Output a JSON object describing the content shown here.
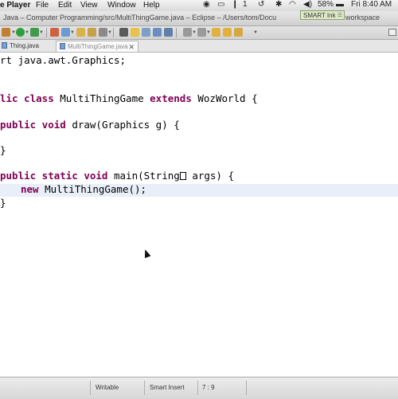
{
  "menubar": {
    "app_name": "e Player",
    "menus": [
      "File",
      "Edit",
      "View",
      "Window",
      "Help"
    ],
    "battery": "58%",
    "clock": "Fri 8:40 AM"
  },
  "smart_ink": {
    "label": "SMART Ink"
  },
  "window": {
    "title": "Java – Computer Programming/src/MultiThingGame.java – Eclipse – /Users/tom/Docu",
    "title_right": "workspace"
  },
  "tabs": [
    {
      "label": "Thing.java"
    },
    {
      "label": "MultiThingGame.java",
      "close": "✕"
    }
  ],
  "code": {
    "line1": {
      "plain": "rt java.awt.Graphics;"
    },
    "line2": {
      "kw1": "lic class ",
      "name": "MultiThingGame ",
      "kw2": "extends ",
      "tail": "WozWorld {"
    },
    "line3": {
      "kw": "public void ",
      "tail": "draw(Graphics g) {"
    },
    "line4": {
      "plain": "}"
    },
    "line5": {
      "kw": "public static void ",
      "head": "main(String",
      "tail": " args) {"
    },
    "line6": {
      "kw": "new ",
      "tail": "MultiThingGame();"
    },
    "line7": {
      "plain": "}"
    }
  },
  "statusbar": {
    "mode": "Writable",
    "insert": "Smart Insert",
    "position": "7 : 9"
  },
  "colors": {
    "keyword": "#7f0055",
    "current_line": "#e9eff8",
    "smart_ink_bg": "#dfe9c9"
  }
}
